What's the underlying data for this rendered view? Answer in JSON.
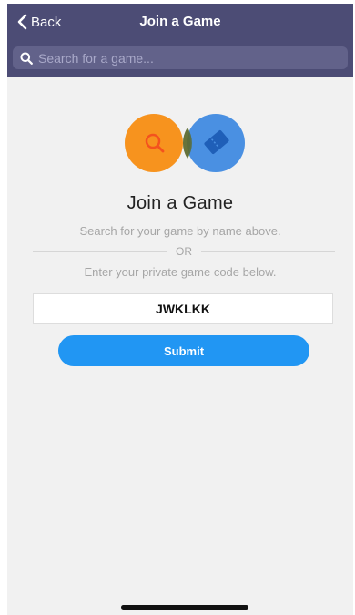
{
  "navbar": {
    "back_label": "Back",
    "title": "Join a Game",
    "background_color": "#4c4c75"
  },
  "search": {
    "placeholder": "Search for a game...",
    "value": ""
  },
  "illustration": {
    "left_icon": "search-icon",
    "left_color": "#f7931e",
    "right_icon": "ticket-icon",
    "right_color": "#4a90e2"
  },
  "main": {
    "heading": "Join a Game",
    "search_hint": "Search for your game by name above.",
    "or_label": "OR",
    "code_hint": "Enter your private game code below.",
    "code_value": "JWKLKK",
    "submit_label": "Submit",
    "accent_color": "#2196f3"
  }
}
